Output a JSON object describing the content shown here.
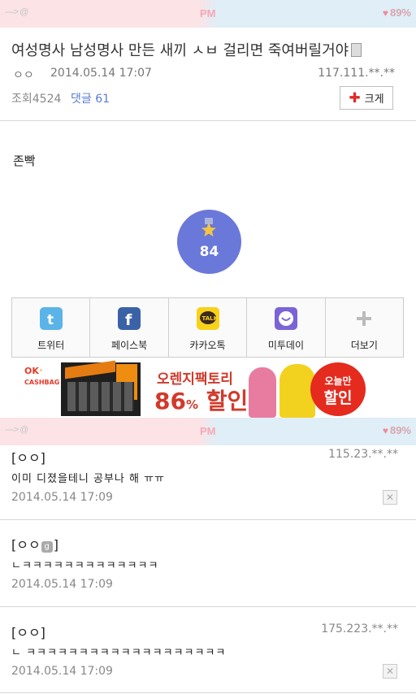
{
  "status_bar_top": {
    "left": "----> @",
    "time": "PM",
    "battery": "89%"
  },
  "status_bar_mid": {
    "left": "----> @",
    "time": "PM",
    "battery": "89%"
  },
  "post": {
    "title": "여성명사 남성명사 만든 새끼 ㅅㅂ 걸리면 죽여버릴거야",
    "author": "ㅇㅇ",
    "date": "2014.05.14 17:07",
    "ip": "117.111.**.**",
    "views_label": "조회",
    "views": "4524",
    "comments_label": "댓글",
    "comments": "61",
    "enlarge_label": "크게",
    "body": "존빡",
    "recommend_count": "84"
  },
  "share": [
    {
      "label": "트위터",
      "icon": "twitter-icon",
      "color": "#5ab4e8"
    },
    {
      "label": "페이스북",
      "icon": "facebook-icon",
      "color": "#3b62a6"
    },
    {
      "label": "카카오톡",
      "icon": "kakaotalk-icon",
      "color": "#f7d21a"
    },
    {
      "label": "미투데이",
      "icon": "me2day-icon",
      "color": "#7a64d6"
    },
    {
      "label": "더보기",
      "icon": "plus-icon",
      "color": "#bbbbbb"
    }
  ],
  "banner": {
    "ok_cashbag": "OK",
    "ok_cashbag_sub": "CASHBAG",
    "line1": "오렌지팩토리",
    "line2_num": "86",
    "line2_pct": "%",
    "line2_text": "할인",
    "badge_top": "오늘만",
    "badge_main": "할인"
  },
  "comments": [
    {
      "author": "[ㅇㅇ]",
      "ip": "115.23.**.**",
      "text": "이미 디졌을테니 공부나 해 ㅠㅠ",
      "date": "2014.05.14 17:09",
      "deletable": true
    },
    {
      "author_pre": "[ㅇㅇ",
      "author_icon": "g",
      "author_post": "]",
      "text": "ㄴㅋㅋㅋㅋㅋㅋㅋㅋㅋㅋㅋㅋㅋ",
      "date": "2014.05.14 17:09",
      "deletable": false
    },
    {
      "author": "[ㅇㅇ]",
      "ip": "175.223.**.**",
      "text": "ㄴ ㅋㅋㅋㅋㅋㅋㅋㅋㅋㅋㅋㅋㅋㅋㅋㅋㅋㅋㅋ",
      "date": "2014.05.14 17:09",
      "deletable": true
    }
  ],
  "colors": {
    "accent": "#6a78d9",
    "link": "#5a7bd4",
    "brand_red": "#d13a2b"
  }
}
